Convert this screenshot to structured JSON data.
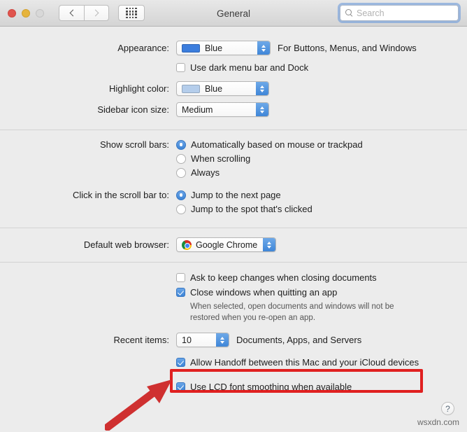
{
  "window": {
    "title": "General",
    "traffic_lights": [
      "close",
      "minimize",
      "zoom"
    ],
    "nav": {
      "back": "‹",
      "forward": "›"
    },
    "grid_button": "all-preferences",
    "search": {
      "placeholder": "Search",
      "value": ""
    }
  },
  "appearance": {
    "label": "Appearance:",
    "value": "Blue",
    "swatch_color": "#3b7ddd",
    "trailing_text": "For Buttons, Menus, and Windows",
    "dark_mode": {
      "label": "Use dark menu bar and Dock",
      "checked": false
    }
  },
  "highlight": {
    "label": "Highlight color:",
    "value": "Blue",
    "swatch_color": "#b4cdeb"
  },
  "sidebar_icon": {
    "label": "Sidebar icon size:",
    "value": "Medium"
  },
  "scroll_bars": {
    "label": "Show scroll bars:",
    "options": [
      {
        "label": "Automatically based on mouse or trackpad",
        "selected": true
      },
      {
        "label": "When scrolling",
        "selected": false
      },
      {
        "label": "Always",
        "selected": false
      }
    ]
  },
  "click_scroll_bar": {
    "label": "Click in the scroll bar to:",
    "options": [
      {
        "label": "Jump to the next page",
        "selected": true
      },
      {
        "label": "Jump to the spot that's clicked",
        "selected": false
      }
    ]
  },
  "web_browser": {
    "label": "Default web browser:",
    "value": "Google Chrome",
    "icon": "chrome-icon"
  },
  "documents": {
    "ask_keep_changes": {
      "label": "Ask to keep changes when closing documents",
      "checked": false
    },
    "close_windows": {
      "label": "Close windows when quitting an app",
      "checked": true
    },
    "helper_line1": "When selected, open documents and windows will not be",
    "helper_line2": "restored when you re-open an app."
  },
  "recent_items": {
    "label": "Recent items:",
    "value": "10",
    "trailing_text": "Documents, Apps, and Servers"
  },
  "handoff": {
    "label": "Allow Handoff between this Mac and your iCloud devices",
    "checked": true,
    "highlight_color": "#e02020"
  },
  "font_smoothing": {
    "label": "Use LCD font smoothing when available",
    "checked": true
  },
  "help": {
    "glyph": "?"
  },
  "watermark": {
    "text": "wsxdn.com"
  }
}
